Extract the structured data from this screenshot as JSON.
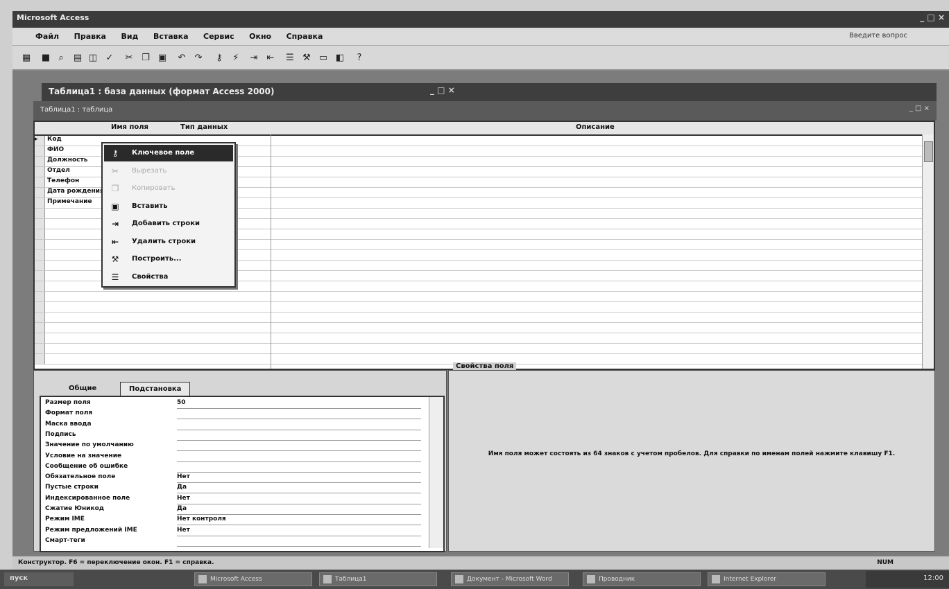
{
  "app": {
    "title": "Microsoft Access",
    "window_controls": "_ □ ×"
  },
  "menu": [
    "Файл",
    "Правка",
    "Вид",
    "Вставка",
    "Сервис",
    "Окно",
    "Справка"
  ],
  "help_box": "Введите вопрос",
  "table_window": {
    "title": "Таблица1 : база данных (формат Access 2000)",
    "subtitle": "Таблица1 : таблица",
    "controls": "_ □ ×"
  },
  "grid": {
    "columns": [
      "Имя поля",
      "Тип данных",
      "Описание"
    ],
    "field_names": [
      "Код",
      "ФИО",
      "Должность",
      "Отдел",
      "Телефон",
      "Дата рождения",
      "Примечание"
    ],
    "row_count": 22
  },
  "context_menu": [
    {
      "label": "Ключевое поле",
      "icon": "key-icon",
      "state": "selected"
    },
    {
      "label": "Вырезать",
      "icon": "cut-icon",
      "state": "disabled"
    },
    {
      "label": "Копировать",
      "icon": "copy-icon",
      "state": "disabled"
    },
    {
      "label": "Вставить",
      "icon": "paste-icon",
      "state": "normal"
    },
    {
      "label": "Добавить строки",
      "icon": "insert-rows-icon",
      "state": "normal"
    },
    {
      "label": "Удалить строки",
      "icon": "delete-rows-icon",
      "state": "normal"
    },
    {
      "label": "Построить...",
      "icon": "build-icon",
      "state": "normal"
    },
    {
      "label": "Свойства",
      "icon": "properties-icon",
      "state": "normal"
    }
  ],
  "properties": {
    "tab_general": "Общие",
    "tab_lookup": "Подстановка",
    "rows": [
      {
        "label": "Размер поля",
        "value": "50"
      },
      {
        "label": "Формат поля",
        "value": ""
      },
      {
        "label": "Маска ввода",
        "value": ""
      },
      {
        "label": "Подпись",
        "value": ""
      },
      {
        "label": "Значение по умолчанию",
        "value": ""
      },
      {
        "label": "Условие на значение",
        "value": ""
      },
      {
        "label": "Сообщение об ошибке",
        "value": ""
      },
      {
        "label": "Обязательное поле",
        "value": "Нет"
      },
      {
        "label": "Пустые строки",
        "value": "Да"
      },
      {
        "label": "Индексированное поле",
        "value": "Нет"
      },
      {
        "label": "Сжатие Юникод",
        "value": "Да"
      },
      {
        "label": "Режим IME",
        "value": "Нет контроля"
      },
      {
        "label": "Режим предложений IME",
        "value": "Нет"
      },
      {
        "label": "Смарт-теги",
        "value": ""
      }
    ]
  },
  "help_pane": {
    "title": "Свойства поля",
    "text": "Имя поля может состоять из 64 знаков с учетом пробелов. Для справки по именам полей нажмите клавишу F1."
  },
  "status": {
    "left": "Конструктор. F6 = переключение окон. F1 = справка.",
    "right": "NUM"
  },
  "taskbar": {
    "start": "пуск",
    "tasks": [
      "Microsoft Access",
      "Таблица1",
      "Документ - Microsoft Word",
      "Проводник",
      "Internet Explorer"
    ],
    "clock": "12:00"
  }
}
